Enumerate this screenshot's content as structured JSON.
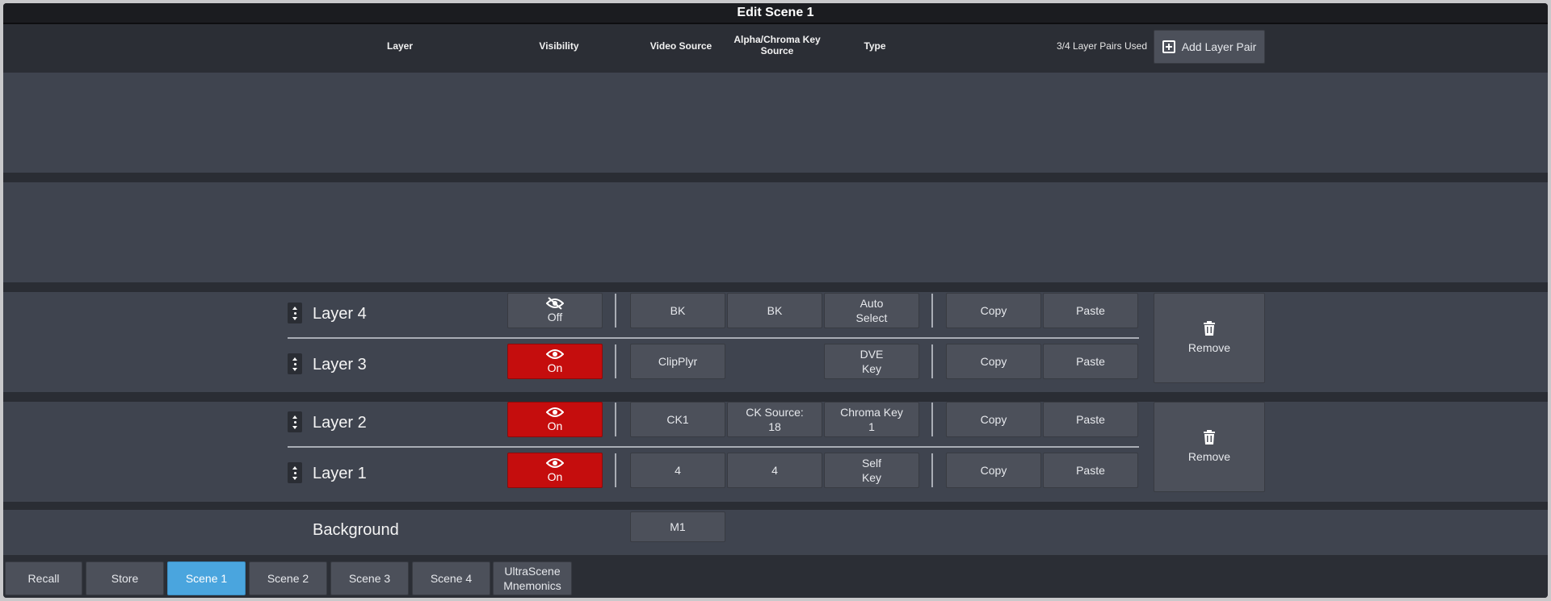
{
  "window": {
    "title": "Edit Scene 1"
  },
  "columns": {
    "layer": "Layer",
    "visibility": "Visibility",
    "video_source": "Video Source",
    "alpha_source": "Alpha/Chroma Key\nSource",
    "type": "Type"
  },
  "pairs_used": "3/4 Layer Pairs Used",
  "add_pair_label": "Add Layer Pair",
  "layers": [
    {
      "name": "Layer 4",
      "visibility": "Off",
      "video": "BK",
      "alpha": "BK",
      "type_line1": "Auto",
      "type_line2": "Select",
      "copy": "Copy",
      "paste": "Paste"
    },
    {
      "name": "Layer 3",
      "visibility": "On",
      "video": "ClipPlyr",
      "alpha": "",
      "type_line1": "DVE",
      "type_line2": "Key",
      "copy": "Copy",
      "paste": "Paste"
    },
    {
      "name": "Layer 2",
      "visibility": "On",
      "video": "CK1",
      "alpha_line1": "CK Source:",
      "alpha_line2": "18",
      "type_line1": "Chroma Key",
      "type_line2": "1",
      "copy": "Copy",
      "paste": "Paste"
    },
    {
      "name": "Layer 1",
      "visibility": "On",
      "video": "4",
      "alpha": "4",
      "type_line1": "Self",
      "type_line2": "Key",
      "copy": "Copy",
      "paste": "Paste"
    }
  ],
  "remove_label": "Remove",
  "background": {
    "label": "Background",
    "source": "M1"
  },
  "bottom_tabs": [
    {
      "label": "Recall"
    },
    {
      "label": "Store"
    },
    {
      "label": "Scene 1"
    },
    {
      "label": "Scene 2"
    },
    {
      "label": "Scene 3"
    },
    {
      "label": "Scene 4"
    },
    {
      "label_line1": "UltraScene",
      "label_line2": "Mnemonics"
    }
  ],
  "colors": {
    "visibility_on": "#c50d0d",
    "active_tab": "#4aa5de",
    "panel": "#3f444f"
  },
  "icons": [
    "eye-icon",
    "eye-slash-icon",
    "trash-icon",
    "plus-square-icon",
    "reorder-icon"
  ]
}
